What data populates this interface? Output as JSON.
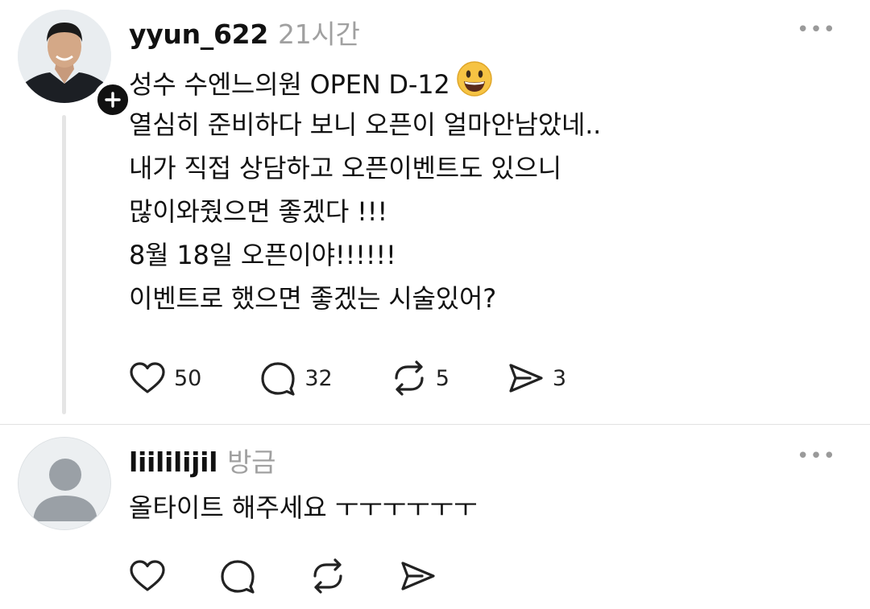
{
  "post": {
    "username": "yyun_622",
    "time": "21시간",
    "more_label": "•••",
    "lines": [
      "성수 수엔느의원 OPEN D-12",
      "열심히 준비하다 보니 오픈이 얼마안남았네..",
      "내가 직접 상담하고 오픈이벤트도 있으니",
      "많이와줬으면 좋겠다 !!!",
      "8월 18일 오픈이야!!!!!!",
      "이벤트로 했으면 좋겠는 시술있어?"
    ],
    "emoji": "smiling-face-emoji",
    "actions": {
      "likes": "50",
      "comments": "32",
      "reposts": "5",
      "shares": "3"
    }
  },
  "reply": {
    "username": "liililijil",
    "time": "방금",
    "more_label": "•••",
    "text": "올타이트 해주세요 ㅜㅜㅜㅜㅜㅜ"
  },
  "icons": {
    "like": "heart-icon",
    "comment": "comment-bubble-icon",
    "repost": "repost-icon",
    "share": "send-icon",
    "follow": "plus-icon"
  },
  "colors": {
    "text": "#111111",
    "muted": "#a0a0a0",
    "divider": "#e2e2e2",
    "thread_line": "#e5e5e5"
  }
}
